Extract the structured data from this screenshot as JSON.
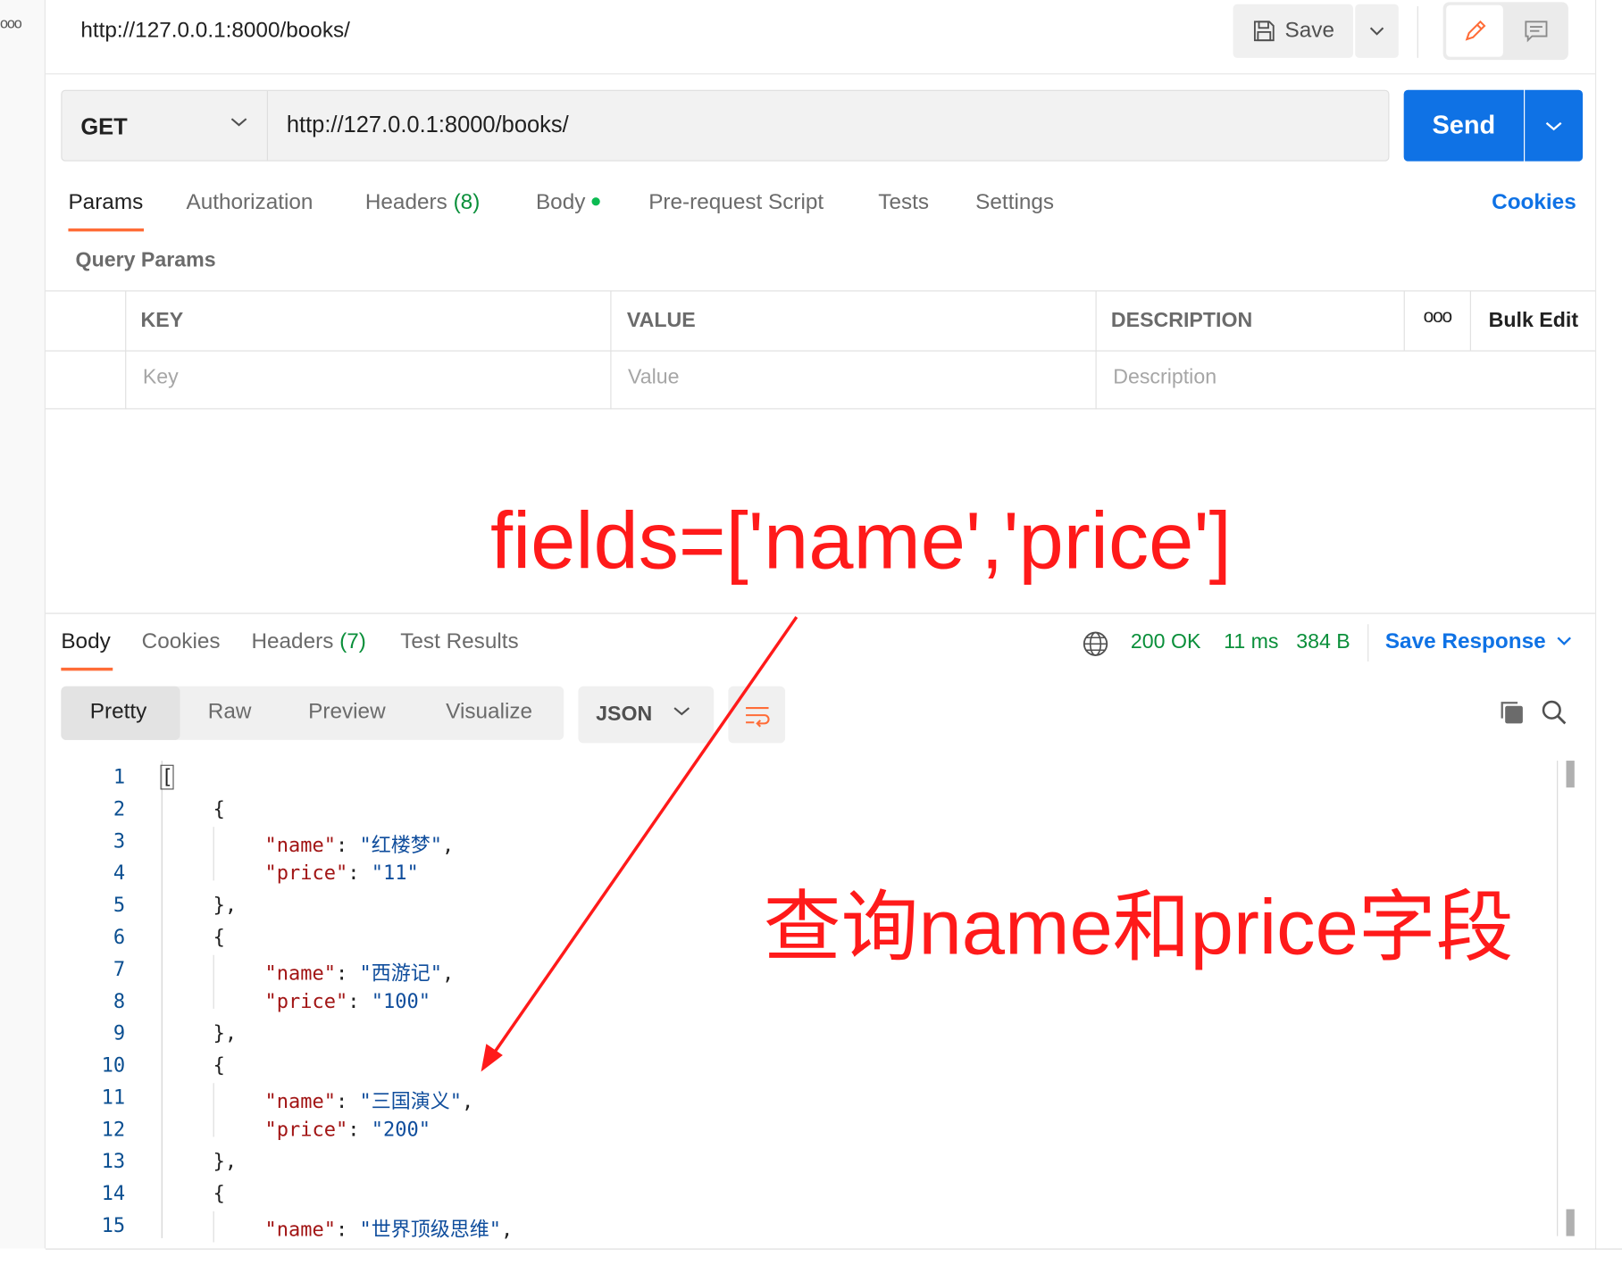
{
  "topbar": {
    "request_title": "http://127.0.0.1:8000/books/",
    "save_label": "Save"
  },
  "request": {
    "method": "GET",
    "url": "http://127.0.0.1:8000/books/",
    "send_label": "Send"
  },
  "request_tabs": {
    "params": "Params",
    "authorization": "Authorization",
    "headers": "Headers",
    "headers_count": "(8)",
    "body": "Body",
    "prerequest": "Pre-request Script",
    "tests": "Tests",
    "settings": "Settings",
    "cookies": "Cookies"
  },
  "query_params": {
    "label": "Query Params",
    "columns": [
      "KEY",
      "VALUE",
      "DESCRIPTION"
    ],
    "placeholders": [
      "Key",
      "Value",
      "Description"
    ],
    "bulk_edit": "Bulk Edit"
  },
  "annotations": {
    "fields_note": "fields=['name','price']",
    "query_note": "查询name和price字段",
    "color": "#ff1a1a"
  },
  "response_tabs": {
    "body": "Body",
    "cookies": "Cookies",
    "headers": "Headers",
    "headers_count": "(7)",
    "test_results": "Test Results"
  },
  "response_status": {
    "status": "200 OK",
    "time": "11 ms",
    "size": "384 B",
    "save_response": "Save Response"
  },
  "response_view": {
    "modes": [
      "Pretty",
      "Raw",
      "Preview",
      "Visualize"
    ],
    "format": "JSON"
  },
  "code_lines": [
    {
      "n": "1"
    },
    {
      "n": "2"
    },
    {
      "n": "3"
    },
    {
      "n": "4"
    },
    {
      "n": "5"
    },
    {
      "n": "6"
    },
    {
      "n": "7"
    },
    {
      "n": "8"
    },
    {
      "n": "9"
    },
    {
      "n": "10"
    },
    {
      "n": "11"
    },
    {
      "n": "12"
    },
    {
      "n": "13"
    },
    {
      "n": "14"
    },
    {
      "n": "15"
    }
  ],
  "code": {
    "open_bracket": "[",
    "open_brace": "{",
    "close_brace": "},",
    "key_name": "\"name\"",
    "key_price": "\"price\"",
    "colon": ": ",
    "comma": ",",
    "books": [
      {
        "name": "\"红楼梦\"",
        "price": "\"11\""
      },
      {
        "name": "\"西游记\"",
        "price": "\"100\""
      },
      {
        "name": "\"三国演义\"",
        "price": "\"200\""
      },
      {
        "name": "\"世界顶级思维\""
      }
    ]
  },
  "colors": {
    "accent_blue": "#0f72e5",
    "tab_orange": "#ff6c37",
    "status_green": "#0a8f3a"
  },
  "icons": [
    "save-icon",
    "chevron-down-icon",
    "pencil-icon",
    "comment-icon",
    "globe-icon",
    "copy-icon",
    "search-icon",
    "wrap-lines-icon",
    "more-icon"
  ]
}
